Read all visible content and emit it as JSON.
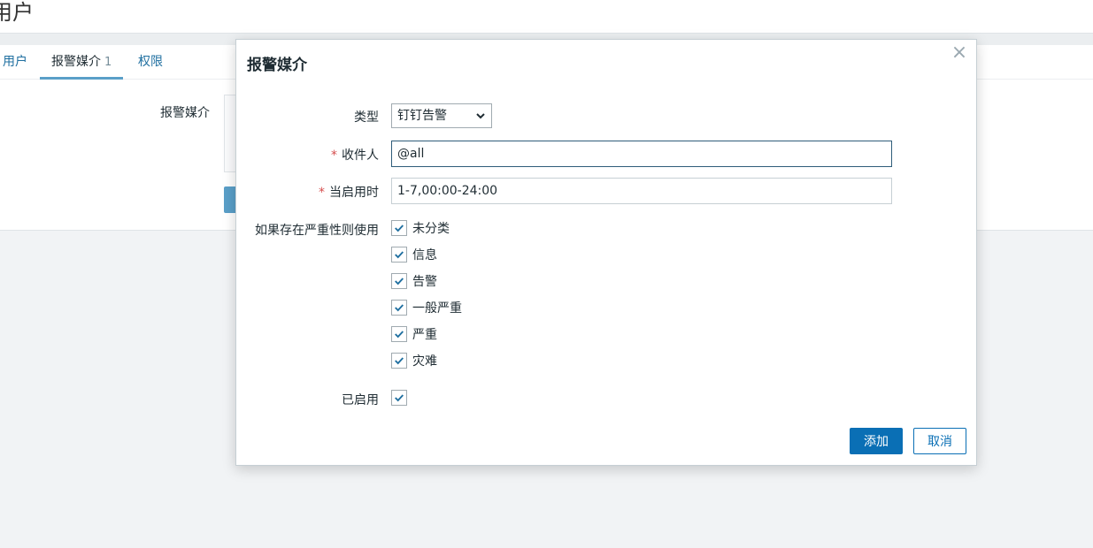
{
  "page": {
    "title": "用户",
    "tabs": [
      {
        "label": "用户"
      },
      {
        "label": "报警媒介",
        "count": "1"
      },
      {
        "label": "权限"
      }
    ],
    "media_label": "报警媒介"
  },
  "dialog": {
    "title": "报警媒介",
    "close_glyph": "×",
    "fields": {
      "type_label": "类型",
      "type_value": "钉钉告警",
      "recipient_label": "收件人",
      "recipient_value": "@all",
      "active_time_label": "当启用时",
      "active_time_value": "1-7,00:00-24:00",
      "severity_label": "如果存在严重性则使用",
      "enabled_label": "已启用"
    },
    "required_mark": "*",
    "severities": [
      {
        "label": "未分类",
        "checked": true
      },
      {
        "label": "信息",
        "checked": true
      },
      {
        "label": "告警",
        "checked": true
      },
      {
        "label": "一般严重",
        "checked": true
      },
      {
        "label": "严重",
        "checked": true
      },
      {
        "label": "灾难",
        "checked": true
      }
    ],
    "enabled": true,
    "buttons": {
      "add": "添加",
      "cancel": "取消"
    }
  },
  "colors": {
    "accent": "#0a6fb5",
    "check": "#1f6fa0",
    "required": "#d64e4e"
  }
}
